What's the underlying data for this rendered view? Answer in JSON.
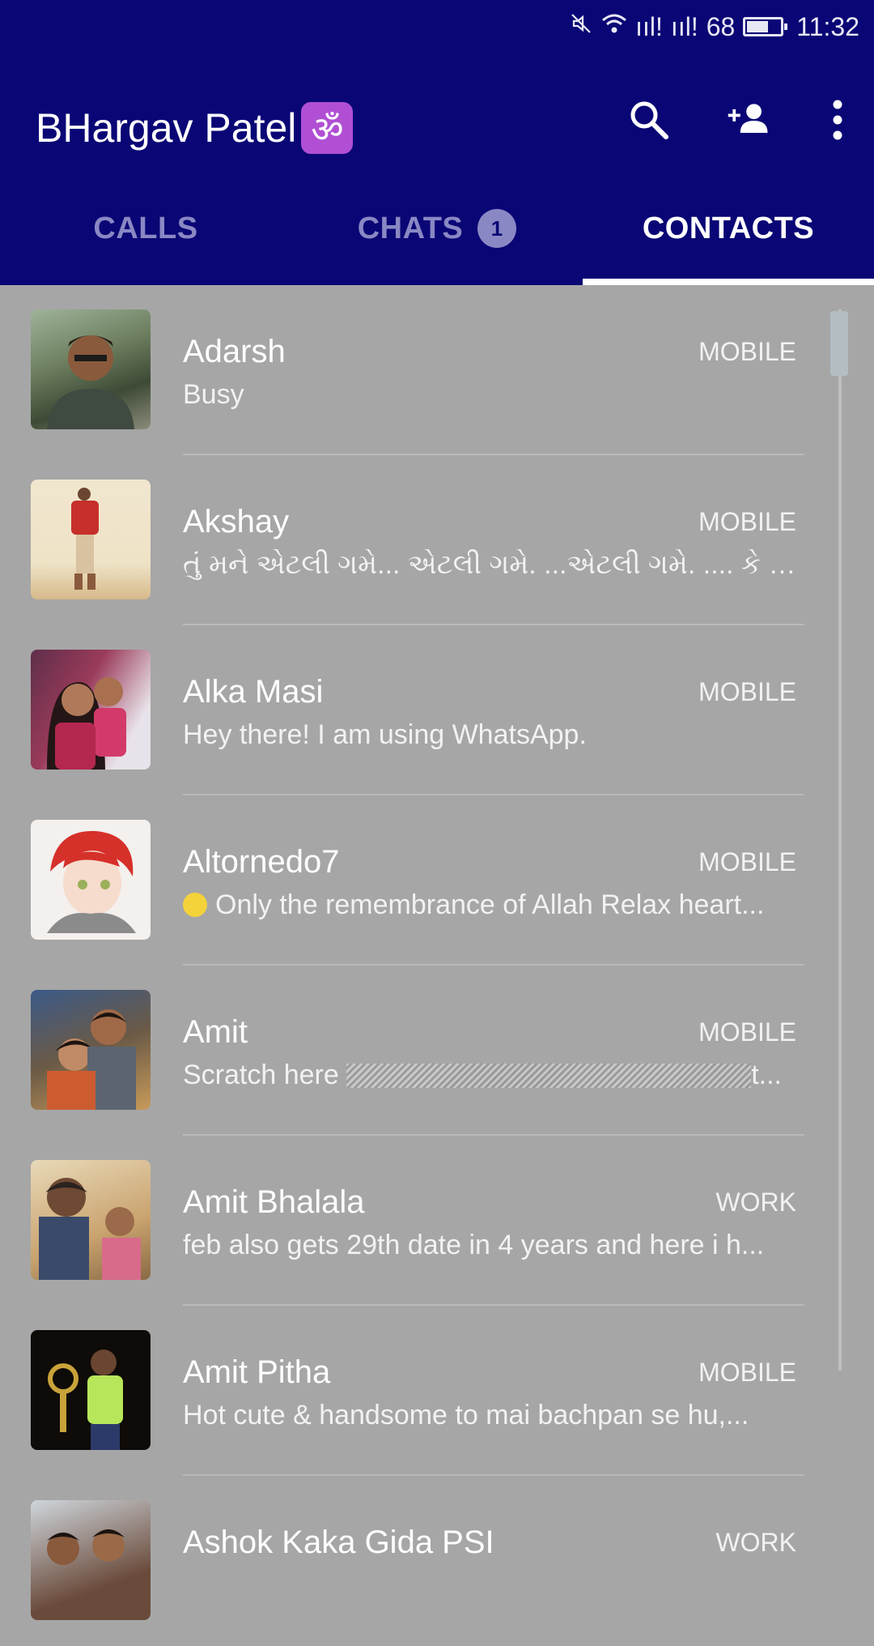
{
  "status_bar": {
    "signal1": "ııl!",
    "signal2": "ııl!",
    "battery": "68",
    "time": "11:32"
  },
  "header": {
    "title": "BHargav Patel",
    "title_emoji": "ॐ",
    "accent": "#0a0675"
  },
  "tabs": {
    "calls": "CALLS",
    "chats": "CHATS",
    "chats_badge": "1",
    "contacts": "CONTACTS"
  },
  "contacts": [
    {
      "name": "Adarsh",
      "type": "MOBILE",
      "status": "Busy"
    },
    {
      "name": "Akshay",
      "type": "MOBILE",
      "status": "તું મને એટલી ગમે... એટલી ગમે. ...એટલી ગમે. .... કે એક ..."
    },
    {
      "name": "Alka Masi",
      "type": "MOBILE",
      "status": "Hey there! I am using WhatsApp."
    },
    {
      "name": "Altornedo7",
      "type": "MOBILE",
      "status": "Only the remembrance of Allah Relax heart..."
    },
    {
      "name": "Amit",
      "type": "MOBILE",
      "status": "Scratch here",
      "status_tail": "t..."
    },
    {
      "name": "Amit Bhalala",
      "type": "WORK",
      "status": "feb also gets 29th date in 4 years and here i h..."
    },
    {
      "name": "Amit Pitha",
      "type": "MOBILE",
      "status": "Hot cute & handsome to mai bachpan se hu,..."
    },
    {
      "name": "Ashok Kaka Gida PSI",
      "type": "WORK",
      "status": ""
    }
  ]
}
